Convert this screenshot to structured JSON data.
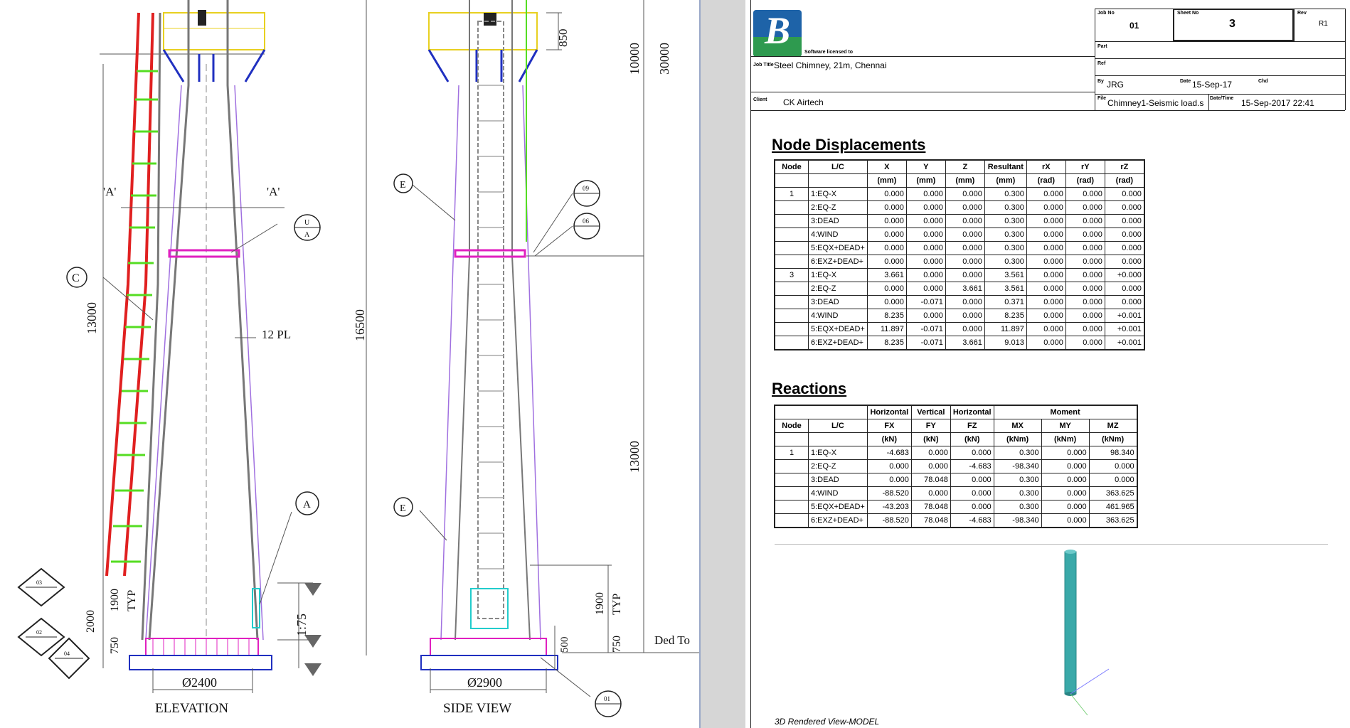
{
  "drawing": {
    "dim_10000": "10000",
    "dim_30000": "30000",
    "dim_850": "850",
    "dim_13000_left": "13000",
    "dim_16500": "16500",
    "dim_13000_right": "13000",
    "dim_1900_left": "1900",
    "dim_typ_left": "TYP",
    "dim_2000": "2000",
    "dim_750_left": "750",
    "dim_1175": "1:75",
    "dim_1900_right": "1900",
    "dim_typ_right": "TYP",
    "dim_750_right": "750",
    "dim_500": "500",
    "plate_note": "12 PL",
    "section_a_left": "'A'",
    "section_a_right": "'A'",
    "label_c": "C",
    "label_a": "A",
    "label_e1": "E",
    "label_e2": "E",
    "bubble_u": "U",
    "bubble_a": "A",
    "bubble_09": "09",
    "bubble_06": "06",
    "bubble_03": "03",
    "bubble_02": "02",
    "bubble_04": "04",
    "bubble_01": "01",
    "diam_elev": "Ø2400",
    "diam_side": "Ø2900",
    "title_elevation": "ELEVATION",
    "title_side": "SIDE VIEW",
    "ded_text": "Ded To"
  },
  "report": {
    "logo_letter": "B",
    "software_licensed": "Software licensed to",
    "job_title_label": "Job Title",
    "job_title": "Steel Chimney, 21m, Chennai",
    "client_label": "Client",
    "client": "CK Airtech",
    "job_no_label": "Job No",
    "job_no": "01",
    "sheet_no_label": "Sheet No",
    "sheet_no": "3",
    "rev_label": "Rev",
    "rev": "R1",
    "part_label": "Part",
    "ref_label": "Ref",
    "by_label": "By",
    "by": "JRG",
    "date_label": "Date",
    "date": "15-Sep-17",
    "chd_label": "Chd",
    "file_label": "File",
    "file": "Chimney1-Seismic load.s",
    "datetime_label": "Date/Time",
    "datetime": "15-Sep-2017 22:41",
    "node_disp_title": "Node Displacements",
    "reactions_title": "Reactions",
    "render_caption": "3D Rendered View-MODEL"
  },
  "node_displacements": {
    "headers": [
      "Node",
      "L/C",
      "X",
      "Y",
      "Z",
      "Resultant",
      "rX",
      "rY",
      "rZ"
    ],
    "units": [
      "",
      "",
      "(mm)",
      "(mm)",
      "(mm)",
      "(mm)",
      "(rad)",
      "(rad)",
      "(rad)"
    ],
    "rows": [
      [
        "1",
        "1:EQ-X",
        "0.000",
        "0.000",
        "0.000",
        "0.300",
        "0.000",
        "0.000",
        "0.000"
      ],
      [
        "",
        "2:EQ-Z",
        "0.000",
        "0.000",
        "0.000",
        "0.300",
        "0.000",
        "0.000",
        "0.000"
      ],
      [
        "",
        "3:DEAD",
        "0.000",
        "0.000",
        "0.000",
        "0.300",
        "0.000",
        "0.000",
        "0.000"
      ],
      [
        "",
        "4:WIND",
        "0.000",
        "0.000",
        "0.000",
        "0.300",
        "0.000",
        "0.000",
        "0.000"
      ],
      [
        "",
        "5:EQX+DEAD+",
        "0.000",
        "0.000",
        "0.000",
        "0.300",
        "0.000",
        "0.000",
        "0.000"
      ],
      [
        "",
        "6:EXZ+DEAD+",
        "0.000",
        "0.000",
        "0.000",
        "0.300",
        "0.000",
        "0.000",
        "0.000"
      ],
      [
        "3",
        "1:EQ-X",
        "3.661",
        "0.000",
        "0.000",
        "3.561",
        "0.000",
        "0.000",
        "+0.000"
      ],
      [
        "",
        "2:EQ-Z",
        "0.000",
        "0.000",
        "3.661",
        "3.561",
        "0.000",
        "0.000",
        "0.000"
      ],
      [
        "",
        "3:DEAD",
        "0.000",
        "-0.071",
        "0.000",
        "0.371",
        "0.000",
        "0.000",
        "0.000"
      ],
      [
        "",
        "4:WIND",
        "8.235",
        "0.000",
        "0.000",
        "8.235",
        "0.000",
        "0.000",
        "+0.001"
      ],
      [
        "",
        "5:EQX+DEAD+",
        "11.897",
        "-0.071",
        "0.000",
        "11.897",
        "0.000",
        "0.000",
        "+0.001"
      ],
      [
        "",
        "6:EXZ+DEAD+",
        "8.235",
        "-0.071",
        "3.661",
        "9.013",
        "0.000",
        "0.000",
        "+0.001"
      ]
    ]
  },
  "reactions": {
    "group_headers": [
      "Horizontal",
      "Vertical",
      "Horizontal",
      "Moment"
    ],
    "headers": [
      "Node",
      "L/C",
      "FX",
      "FY",
      "FZ",
      "MX",
      "MY",
      "MZ"
    ],
    "units": [
      "",
      "",
      "(kN)",
      "(kN)",
      "(kN)",
      "(kNm)",
      "(kNm)",
      "(kNm)"
    ],
    "rows": [
      [
        "1",
        "1:EQ-X",
        "-4.683",
        "0.000",
        "0.000",
        "0.300",
        "0.000",
        "98.340"
      ],
      [
        "",
        "2:EQ-Z",
        "0.000",
        "0.000",
        "-4.683",
        "-98.340",
        "0.000",
        "0.000"
      ],
      [
        "",
        "3:DEAD",
        "0.000",
        "78.048",
        "0.000",
        "0.300",
        "0.000",
        "0.000"
      ],
      [
        "",
        "4:WIND",
        "-88.520",
        "0.000",
        "0.000",
        "0.300",
        "0.000",
        "363.625"
      ],
      [
        "",
        "5:EQX+DEAD+",
        "-43.203",
        "78.048",
        "0.000",
        "0.300",
        "0.000",
        "461.965"
      ],
      [
        "",
        "6:EXZ+DEAD+",
        "-88.520",
        "78.048",
        "-4.683",
        "-98.340",
        "0.000",
        "363.625"
      ]
    ]
  },
  "colors": {
    "ladder_red": "#e02020",
    "rung_green": "#55dd22",
    "magenta": "#e020c0",
    "blue": "#2030c0",
    "purple": "#a070e0",
    "cyan_render": "#3aa9a9",
    "yellow": "#e8d020"
  }
}
